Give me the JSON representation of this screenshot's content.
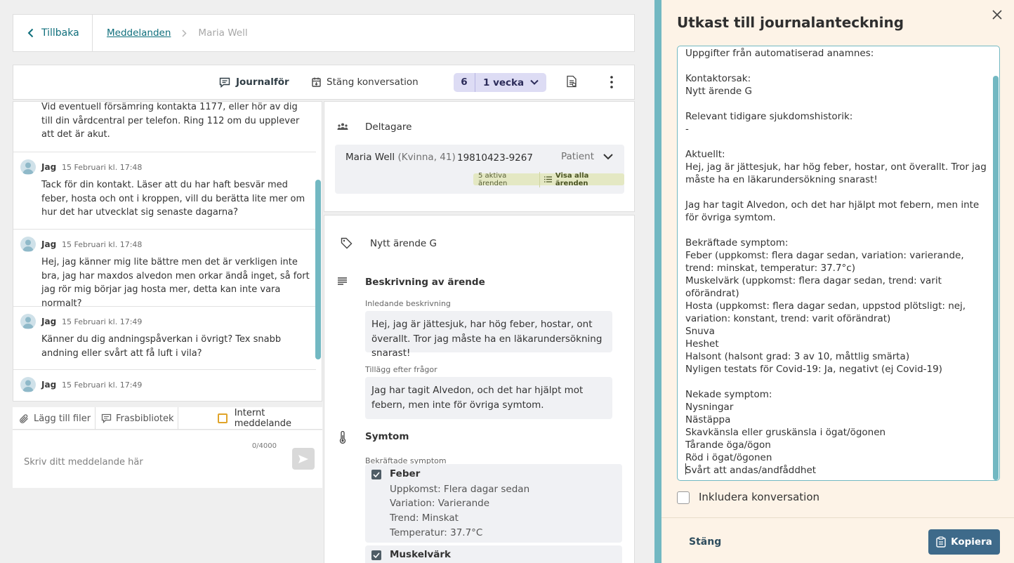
{
  "nav": {
    "back_label": "Tillbaka",
    "breadcrumb_link": "Meddelanden",
    "breadcrumb_current": "Maria Well"
  },
  "toolbar": {
    "journal_label": "Journalför",
    "close_conv_label": "Stäng konversation",
    "pill_count": "6",
    "pill_period": "1 vecka"
  },
  "messages": [
    {
      "body": "Vid eventuell försämring kontakta 1177, eller hör av dig till din vårdcentral per telefon. Ring 112 om du upplever att det är akut."
    },
    {
      "author": "Jag",
      "time": "15 Februari kl. 17:48",
      "body": "Tack för din kontakt. Läser att du har haft besvär med feber, hosta och ont i kroppen, vill du berätta lite mer om hur det har utvecklat sig senaste dagarna?"
    },
    {
      "author": "Jag",
      "time": "15 Februari kl. 17:48",
      "body": "Hej, jag känner mig lite bättre men det är verkligen inte bra, jag har maxdos alvedon men orkar ändå inget, så fort jag rör mig börjar jag hosta mer, detta kan inte vara normalt?"
    },
    {
      "author": "Jag",
      "time": "15 Februari kl. 17:49",
      "body": "Känner du dig andningspåverkan i övrigt? Tex snabb andning eller svårt att få luft i vila?"
    },
    {
      "author": "Jag",
      "time": "15 Februari kl. 17:49",
      "body": ""
    }
  ],
  "composer": {
    "files_label": "Lägg till filer",
    "phrases_label": "Frasbibliotek",
    "internal_label": "Internt meddelande",
    "char_count": "0/4000",
    "placeholder": "Skriv ditt meddelande här"
  },
  "participants": {
    "title": "Deltagare",
    "name": "Maria Well",
    "meta": "(Kvinna, 41)",
    "personal_number": "19810423-9267",
    "role": "Patient",
    "active_cases": "5 aktiva ärenden",
    "show_all": "Visa alla ärenden"
  },
  "case": {
    "title": "Nytt ärende G",
    "description_title": "Beskrivning av ärende",
    "initial_label": "Inledande beskrivning",
    "initial_text": "Hej, jag är jättesjuk, har hög feber, hostar, ont överallt. Tror jag måste ha en läkarundersökning snarast!",
    "followup_label": "Tillägg efter frågor",
    "followup_text": "Jag har tagit Alvedon, och det har hjälpt mot febern, men inte för övriga symtom.",
    "symptoms_title": "Symtom",
    "confirmed_label": "Bekräftade symptom",
    "symptoms": [
      {
        "name": "Feber",
        "onset": "Uppkomst: Flera dagar sedan",
        "variation": "Variation: Varierande",
        "trend": "Trend: Minskat",
        "temp": "Temperatur: 37.7°C"
      },
      {
        "name": "Muskelvärk"
      }
    ]
  },
  "panel": {
    "title": "Utkast till journalanteckning",
    "note_text": "Uppgifter från automatiserad anamnes:\n\nKontaktorsak:\nNytt ärende G\n\nRelevant tidigare sjukdomshistorik:\n-\n\nAktuellt:\nHej, jag är jättesjuk, har hög feber, hostar, ont överallt. Tror jag måste ha en läkarundersökning snarast!\n\nJag har tagit Alvedon, och det har hjälpt mot febern, men inte för övriga symtom.\n\nBekräftade symptom:\nFeber (uppkomst: flera dagar sedan, variation: varierande, trend: minskat, temperatur: 37.7°c)\nMuskelvärk (uppkomst: flera dagar sedan, trend: varit oförändrat)\nHosta (uppkomst: flera dagar sedan, uppstod plötsligt: nej, variation: konstant, trend: varit oförändrat)\nSnuva\nHeshet\nHalsont (halsont grad: 3 av 10, måttlig smärta)\nNyligen testats för Covid-19: Ja, negativt (ej Covid-19)\n\nNekade symptom:\nNysningar\nNästäppa\nSkavkänsla eller gruskänsla i ögat/ögonen\nTårande öga/ögon\nRöd i ögat/ögonen\nSvårt att andas/andfåddhet",
    "include_label": "Inkludera konversation",
    "close_label": "Stäng",
    "copy_label": "Kopiera"
  },
  "colors": {
    "accent": "#72b8c2",
    "link": "#0f6f7c",
    "primary_button": "#3e6a8a",
    "panel_bg": "#fdf3e7",
    "pill_bg": "#dddcf4"
  }
}
